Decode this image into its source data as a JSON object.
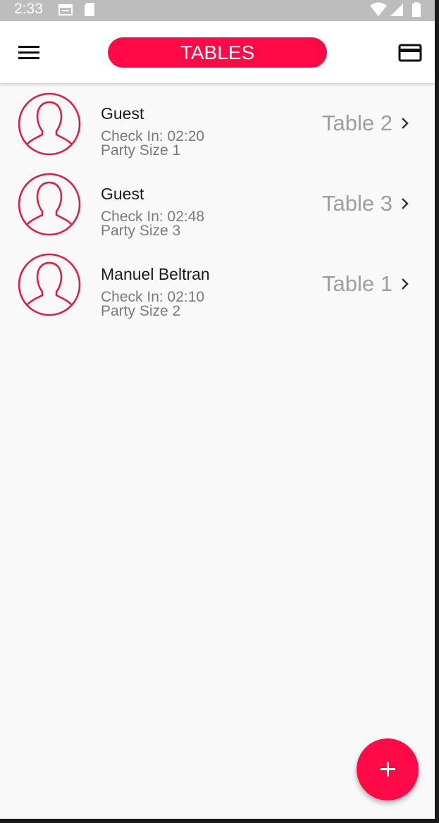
{
  "status_bar": {
    "time": "2:33",
    "icons": [
      "calendar-icon",
      "sd-card-icon",
      "wifi-icon",
      "signal-icon",
      "battery-icon"
    ]
  },
  "app_bar": {
    "title": "TABLES",
    "menu_icon": "hamburger-menu-icon",
    "action_icon": "credit-card-icon"
  },
  "colors": {
    "accent": "#ff0a47",
    "background": "#f9f9f9",
    "status_bar": "#bdbdbd"
  },
  "tables": [
    {
      "guest_name": "Guest",
      "check_in": "Check In: 02:20",
      "party_size": "Party Size 1",
      "table": "Table 2"
    },
    {
      "guest_name": "Guest",
      "check_in": "Check In: 02:48",
      "party_size": "Party Size 3",
      "table": "Table 3"
    },
    {
      "guest_name": "Manuel Beltran",
      "check_in": "Check In: 02:10",
      "party_size": "Party Size 2",
      "table": "Table 1"
    }
  ],
  "fab": {
    "icon": "plus-icon"
  }
}
